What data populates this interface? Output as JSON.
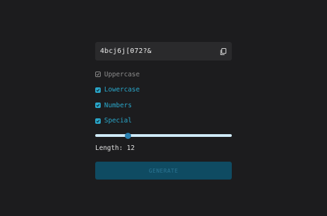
{
  "password": {
    "value": "4bcj6j[072?&"
  },
  "icons": {
    "copy": "copy-icon",
    "check": "checkmark-icon"
  },
  "options": [
    {
      "label": "Uppercase",
      "checked": false
    },
    {
      "label": "Lowercase",
      "checked": true
    },
    {
      "label": "Numbers",
      "checked": true
    },
    {
      "label": "Special",
      "checked": true
    }
  ],
  "length": {
    "label": "Length: 12",
    "value": 12
  },
  "actions": {
    "generate_label": "GENERATE"
  },
  "colors": {
    "accent": "#2aa6c9",
    "background": "#1c1c1e",
    "button": "#0f4b62"
  }
}
